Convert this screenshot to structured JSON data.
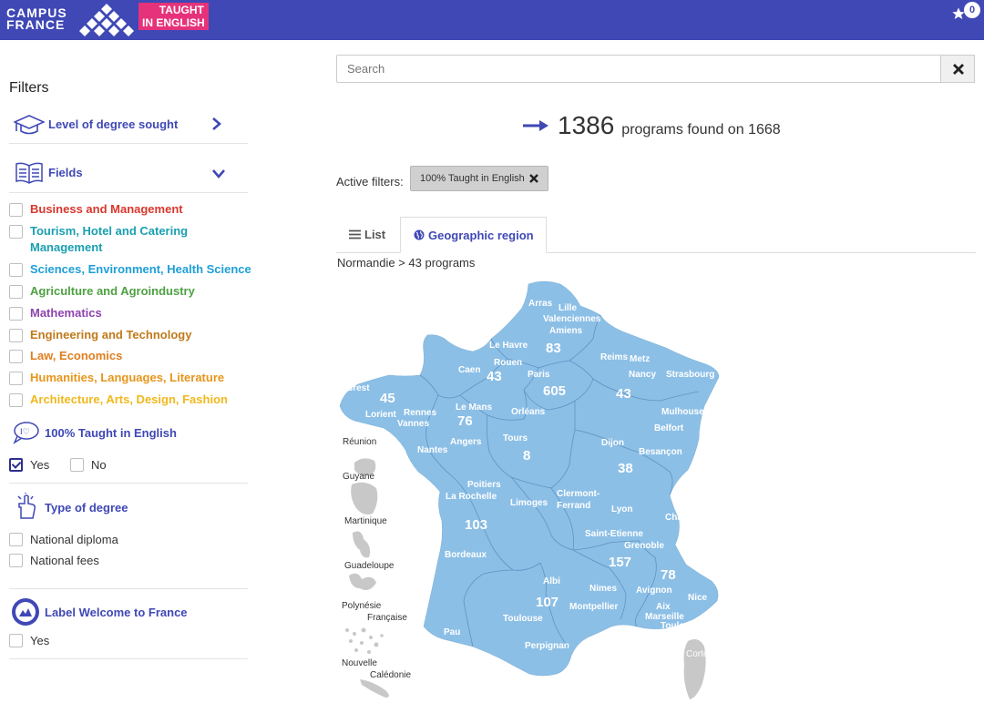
{
  "header": {
    "logo_line1": "CAMPUS",
    "logo_line2": "FRANCE",
    "badge_line1": "TAUGHT",
    "badge_line2": "IN ENGLISH",
    "favorites_count": "0"
  },
  "sidebar": {
    "title": "Filters",
    "level_label": "Level of degree sought",
    "fields_label": "Fields",
    "fields": [
      {
        "label": "Business and Management",
        "color": "#d9372c"
      },
      {
        "label": "Tourism, Hotel and Catering Management",
        "color": "#1a9fb0"
      },
      {
        "label": "Sciences, Environment, Health Science",
        "color": "#1e9fd8"
      },
      {
        "label": "Agriculture and Agroindustry",
        "color": "#4ea142"
      },
      {
        "label": "Mathematics",
        "color": "#8e44ad"
      },
      {
        "label": "Engineering and Technology",
        "color": "#c07a1a"
      },
      {
        "label": "Law, Economics",
        "color": "#e07e1e"
      },
      {
        "label": "Humanities, Languages, Literature",
        "color": "#e8951a"
      },
      {
        "label": "Architecture, Arts, Design, Fashion",
        "color": "#f0b81d"
      }
    ],
    "taught_label": "100% Taught in English",
    "yes_label": "Yes",
    "no_label": "No",
    "yes_checked": true,
    "type_label": "Type of degree",
    "type_options": [
      "National diploma",
      "National fees"
    ],
    "welcome_label": "Label Welcome to France",
    "welcome_yes": "Yes"
  },
  "main": {
    "search_placeholder": "Search",
    "results_count": "1386",
    "results_text": "programs found on 1668",
    "active_filters_label": "Active filters:",
    "active_chip": "100% Taught in English",
    "tab_list": "List",
    "tab_geo": "Geographic region",
    "breadcrumb": "Normandie > 43 programs"
  },
  "map": {
    "accent_color": "#8cbfe6",
    "overseas": [
      "Réunion",
      "Guyane",
      "Martinique",
      "Guadeloupe",
      "Polynésie",
      "Française",
      "Nouvelle",
      "Calédonie",
      "Corte"
    ],
    "region_counts": [
      "83",
      "43",
      "605",
      "43",
      "45",
      "76",
      "8",
      "38",
      "103",
      "157",
      "78",
      "107"
    ],
    "cities": [
      "Arras",
      "Lille",
      "Valenciennes",
      "Amiens",
      "Le Havre",
      "Rouen",
      "Caen",
      "Paris",
      "Reims",
      "Metz",
      "Nancy",
      "Strasbourg",
      "Brest",
      "Lorient",
      "Rennes",
      "Vannes",
      "Le Mans",
      "Orléans",
      "Angers",
      "Tours",
      "Nantes",
      "Mulhouse",
      "Belfort",
      "Dijon",
      "Besançon",
      "Poitiers",
      "La Rochelle",
      "Limoges",
      "Clermont-",
      "Ferrand",
      "Lyon",
      "Chambery",
      "Saint-Etienne",
      "Grenoble",
      "Bordeaux",
      "Albi",
      "Nimes",
      "Avignon",
      "Montpellier",
      "Aix",
      "Marseille",
      "Nice",
      "Toulon",
      "Toulouse",
      "Pau",
      "Perpignan"
    ]
  }
}
